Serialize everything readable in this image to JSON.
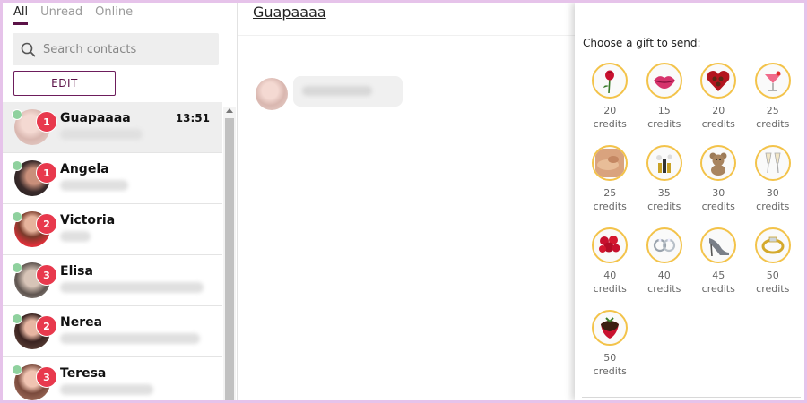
{
  "tabs": [
    {
      "label": "All",
      "active": true
    },
    {
      "label": "Unread",
      "active": false
    },
    {
      "label": "Online",
      "active": false
    }
  ],
  "search": {
    "placeholder": "Search contacts",
    "icon": "search-icon"
  },
  "edit_button": {
    "label": "EDIT"
  },
  "contacts": [
    {
      "name": "Guapaaaa",
      "time": "13:51",
      "unread": "1",
      "online": true,
      "selected": true
    },
    {
      "name": "Angela",
      "time": "",
      "unread": "1",
      "online": true,
      "selected": false
    },
    {
      "name": "Victoria",
      "time": "",
      "unread": "2",
      "online": true,
      "selected": false
    },
    {
      "name": "Elisa",
      "time": "",
      "unread": "3",
      "online": true,
      "selected": false
    },
    {
      "name": "Nerea",
      "time": "",
      "unread": "2",
      "online": true,
      "selected": false
    },
    {
      "name": "Teresa",
      "time": "",
      "unread": "3",
      "online": true,
      "selected": false
    }
  ],
  "conversation": {
    "title": "Guapaaaa"
  },
  "gift_panel": {
    "heading": "Choose a gift to send:",
    "unit": "credits",
    "gifts": [
      {
        "icon": "rose-icon",
        "price": "20"
      },
      {
        "icon": "lips-icon",
        "price": "15"
      },
      {
        "icon": "chocolate-box-icon",
        "price": "20"
      },
      {
        "icon": "cocktail-icon",
        "price": "25"
      },
      {
        "icon": "massage-icon",
        "price": "25"
      },
      {
        "icon": "champagne-bottle-icon",
        "price": "35"
      },
      {
        "icon": "teddy-bear-icon",
        "price": "30"
      },
      {
        "icon": "champagne-glasses-icon",
        "price": "30"
      },
      {
        "icon": "roses-bouquet-icon",
        "price": "40"
      },
      {
        "icon": "earrings-icon",
        "price": "40"
      },
      {
        "icon": "high-heels-icon",
        "price": "45"
      },
      {
        "icon": "ring-icon",
        "price": "50"
      },
      {
        "icon": "chocolate-strawberry-icon",
        "price": "50"
      }
    ]
  },
  "colors": {
    "accent": "#5b1247",
    "badge": "#e8394d",
    "online": "#8fd19e",
    "gift_border": "#f3c34a",
    "page_border": "#e6c3ea"
  }
}
